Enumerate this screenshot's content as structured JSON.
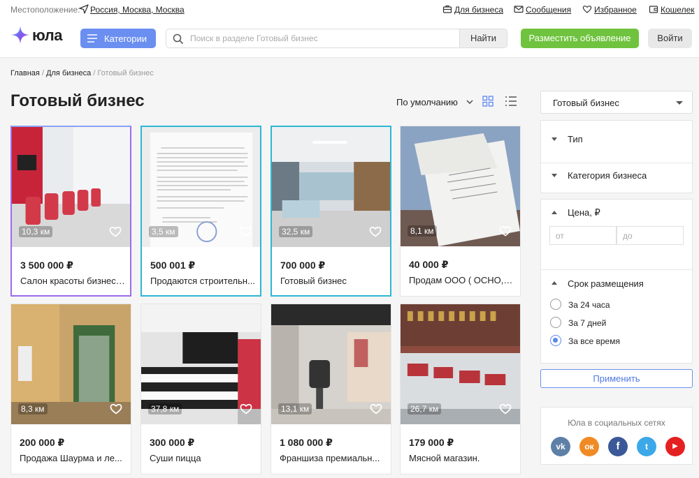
{
  "topbar": {
    "location_label": "Местоположение:",
    "location_value": "Россия, Москва, Москва",
    "links": [
      {
        "label": "Для бизнеса",
        "icon": "briefcase-icon"
      },
      {
        "label": "Сообщения",
        "icon": "envelope-icon"
      },
      {
        "label": "Избранное",
        "icon": "heart-icon"
      },
      {
        "label": "Кошелек",
        "icon": "wallet-icon"
      }
    ]
  },
  "header": {
    "logo_text": "юла",
    "categories_label": "Категории",
    "search_placeholder": "Поиск в разделе Готовый бизнес",
    "search_button": "Найти",
    "post_button": "Разместить объявление",
    "login_button": "Войти"
  },
  "breadcrumbs": [
    "Главная",
    "Для бизнеса",
    "Готовый бизнес"
  ],
  "page_title": "Готовый бизнес",
  "sort_label": "По умолчанию",
  "listings": [
    {
      "price": "3 500 000 ₽",
      "name": "Салон красоты бизнес ...",
      "distance": "10,3 км"
    },
    {
      "price": "500 001 ₽",
      "name": "Продаются строительн...",
      "distance": "3,5 км"
    },
    {
      "price": "700 000 ₽",
      "name": "Готовый бизнес",
      "distance": "32,5 км"
    },
    {
      "price": "40 000 ₽",
      "name": "Продам ООО ( ОСНО, У...",
      "distance": "8,1 км"
    },
    {
      "price": "200 000 ₽",
      "name": "Продажа Шаурма и ле...",
      "distance": "8,3 км"
    },
    {
      "price": "300 000 ₽",
      "name": "Суши пицца",
      "distance": "37,8 км"
    },
    {
      "price": "1 080 000 ₽",
      "name": "Франшиза премиальн...",
      "distance": "13,1 км"
    },
    {
      "price": "179 000 ₽",
      "name": "Мясной магазин.",
      "distance": "26,7 км"
    }
  ],
  "sidebar": {
    "category_select": "Готовый бизнес",
    "filter_type": "Тип",
    "filter_business_category": "Категория бизнеса",
    "price_label": "Цена, ₽",
    "price_from_placeholder": "от",
    "price_to_placeholder": "до",
    "period_label": "Срок размещения",
    "period_options": [
      "За 24 часа",
      "За 7 дней",
      "За все время"
    ],
    "period_selected": "За все время",
    "apply_button": "Применить",
    "social_label": "Юла в социальных сетях",
    "social": [
      {
        "name": "vk",
        "label": "vk",
        "color": "#5e7fa6"
      },
      {
        "name": "odnoklassniki",
        "label": "ок",
        "color": "#f08a24"
      },
      {
        "name": "facebook",
        "label": "f",
        "color": "#3b5998"
      },
      {
        "name": "twitter",
        "label": "t",
        "color": "#3ca8e8"
      },
      {
        "name": "youtube",
        "label": "▶",
        "color": "#e52020"
      }
    ]
  },
  "colors": {
    "accent_blue": "#6a8ff1",
    "accent_green": "#70c33f",
    "selection_cyan": "#2bb8d3"
  }
}
